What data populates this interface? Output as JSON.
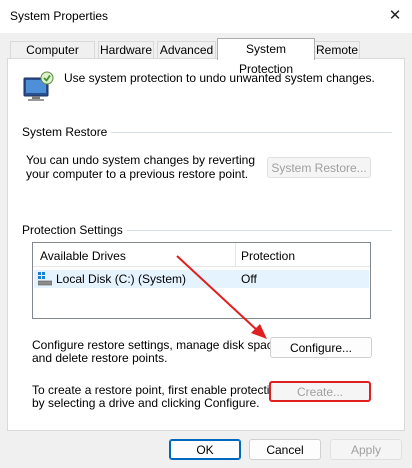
{
  "window": {
    "title": "System Properties",
    "close_glyph": "✕"
  },
  "tabs": [
    "Computer Name",
    "Hardware",
    "Advanced",
    "System Protection",
    "Remote"
  ],
  "active_tab": "System Protection",
  "intro": {
    "icon": "system-protection-icon",
    "text": "Use system protection to undo unwanted system changes."
  },
  "system_restore": {
    "label": "System Restore",
    "line1": "You can undo system changes by reverting",
    "line2": "your computer to a previous restore point.",
    "button": "System Restore..."
  },
  "protection_settings": {
    "label": "Protection Settings",
    "columns": [
      "Available Drives",
      "Protection"
    ],
    "drives": [
      {
        "name": "Local Disk (C:) (System)",
        "protection": "Off",
        "icon": "drive-icon"
      }
    ],
    "configure_line1": "Configure restore settings, manage disk space,",
    "configure_line2": "and delete restore points.",
    "configure_button": "Configure...",
    "create_line1": "To create a restore point, first enable protection",
    "create_line2": "by selecting a drive and clicking Configure.",
    "create_button": "Create..."
  },
  "footer": {
    "ok": "OK",
    "cancel": "Cancel",
    "apply": "Apply"
  },
  "annotation": {
    "arrow_color": "#e02020",
    "highlight_color": "#e02020"
  }
}
